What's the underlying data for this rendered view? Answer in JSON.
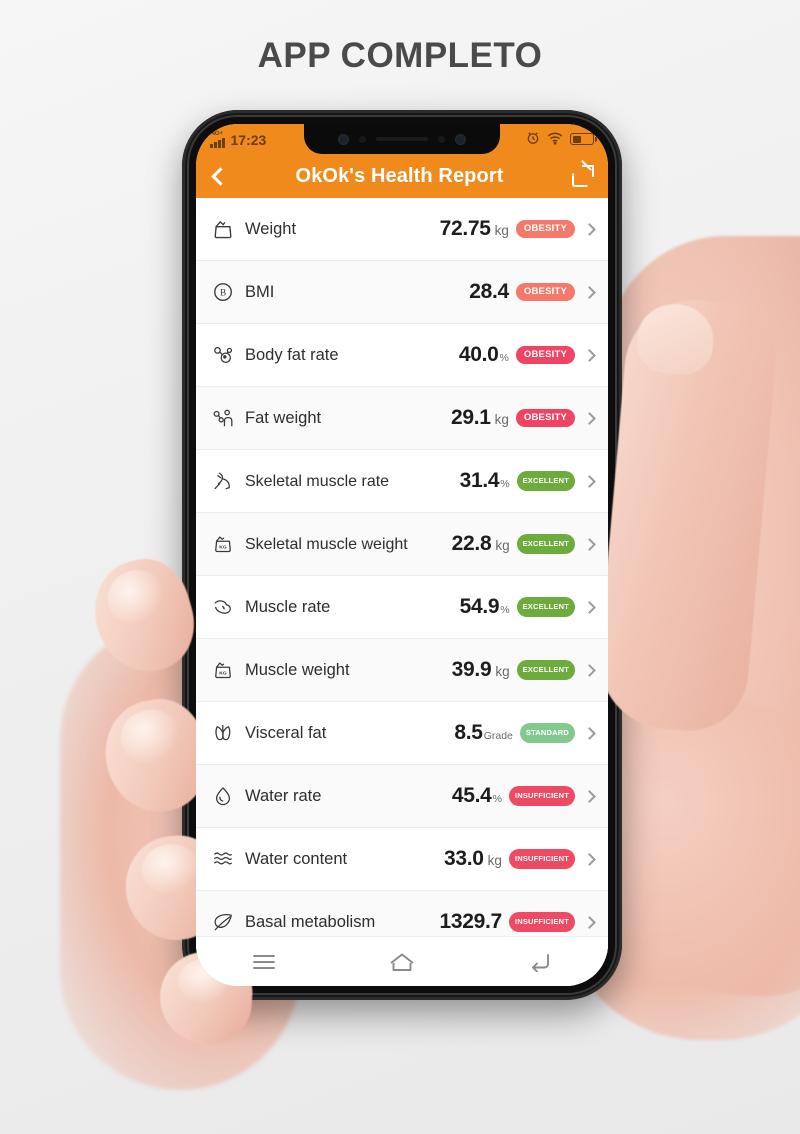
{
  "page": {
    "heading": "APP COMPLETO",
    "background_color": "#f2f2f2",
    "heading_color": "#4a4a4a"
  },
  "phone": {
    "status_bar": {
      "network_label": "4G+",
      "time": "17:23",
      "icons": [
        "alarm-icon",
        "wifi-icon",
        "battery-icon"
      ],
      "background_color": "#f08a1c"
    },
    "app_bar": {
      "back_label": "",
      "title": "OkOk's Health Report",
      "share_label": "",
      "background_color": "#f08a1c",
      "text_color": "#ffffff"
    },
    "nav_bar": {
      "items": [
        {
          "name": "recents-button",
          "label": ""
        },
        {
          "name": "home-button",
          "label": ""
        },
        {
          "name": "back-button",
          "label": ""
        }
      ]
    }
  },
  "colors": {
    "obesity_light": "#f4796a",
    "obesity_strong": "#ef4463",
    "excellent": "#6cab3c",
    "standard": "#83c98f",
    "insufficient": "#ef4a63",
    "accent_orange": "#f08a1c"
  },
  "report": {
    "rows": [
      {
        "icon": "scale-icon",
        "label": "Weight",
        "value": "72.75",
        "unit": "kg",
        "unit_size": "normal",
        "badge": "OBESITY",
        "badge_color": "#f4796a",
        "badge_size": "normal"
      },
      {
        "icon": "bmi-icon",
        "label": "BMI",
        "value": "28.4",
        "unit": "",
        "unit_size": "normal",
        "badge": "OBESITY",
        "badge_color": "#f4796a",
        "badge_size": "normal"
      },
      {
        "icon": "fat-cells-icon",
        "label": "Body fat rate",
        "value": "40.0",
        "unit": "%",
        "unit_size": "small",
        "badge": "OBESITY",
        "badge_color": "#ef4463",
        "badge_size": "normal"
      },
      {
        "icon": "fat-body-icon",
        "label": "Fat weight",
        "value": "29.1",
        "unit": "kg",
        "unit_size": "normal",
        "badge": "OBESITY",
        "badge_color": "#ef4463",
        "badge_size": "normal"
      },
      {
        "icon": "skeletal-leg-icon",
        "label": "Skeletal muscle rate",
        "value": "31.4",
        "unit": "%",
        "unit_size": "small",
        "badge": "EXCELLENT",
        "badge_color": "#6cab3c",
        "badge_size": "tiny"
      },
      {
        "icon": "kg-tag-icon",
        "label": "Skeletal muscle weight",
        "value": "22.8",
        "unit": "kg",
        "unit_size": "normal",
        "badge": "EXCELLENT",
        "badge_color": "#6cab3c",
        "badge_size": "tiny"
      },
      {
        "icon": "bicep-icon",
        "label": "Muscle rate",
        "value": "54.9",
        "unit": "%",
        "unit_size": "small",
        "badge": "EXCELLENT",
        "badge_color": "#6cab3c",
        "badge_size": "tiny"
      },
      {
        "icon": "kg-tag-icon",
        "label": "Muscle weight",
        "value": "39.9",
        "unit": "kg",
        "unit_size": "normal",
        "badge": "EXCELLENT",
        "badge_color": "#6cab3c",
        "badge_size": "tiny"
      },
      {
        "icon": "organ-icon",
        "label": "Visceral fat",
        "value": "8.5",
        "unit": "Grade",
        "unit_size": "small",
        "badge": "STANDARD",
        "badge_color": "#83c98f",
        "badge_size": "tiny"
      },
      {
        "icon": "water-drop-icon",
        "label": "Water rate",
        "value": "45.4",
        "unit": "%",
        "unit_size": "small",
        "badge": "INSUFFICIENT",
        "badge_color": "#ef4a63",
        "badge_size": "tiny"
      },
      {
        "icon": "waves-icon",
        "label": "Water content",
        "value": "33.0",
        "unit": "kg",
        "unit_size": "normal",
        "badge": "INSUFFICIENT",
        "badge_color": "#ef4a63",
        "badge_size": "tiny"
      },
      {
        "icon": "leaf-icon",
        "label": "Basal metabolism",
        "value": "1329.7",
        "unit": "",
        "unit_size": "normal",
        "badge": "INSUFFICIENT",
        "badge_color": "#ef4a63",
        "badge_size": "tiny"
      }
    ]
  }
}
